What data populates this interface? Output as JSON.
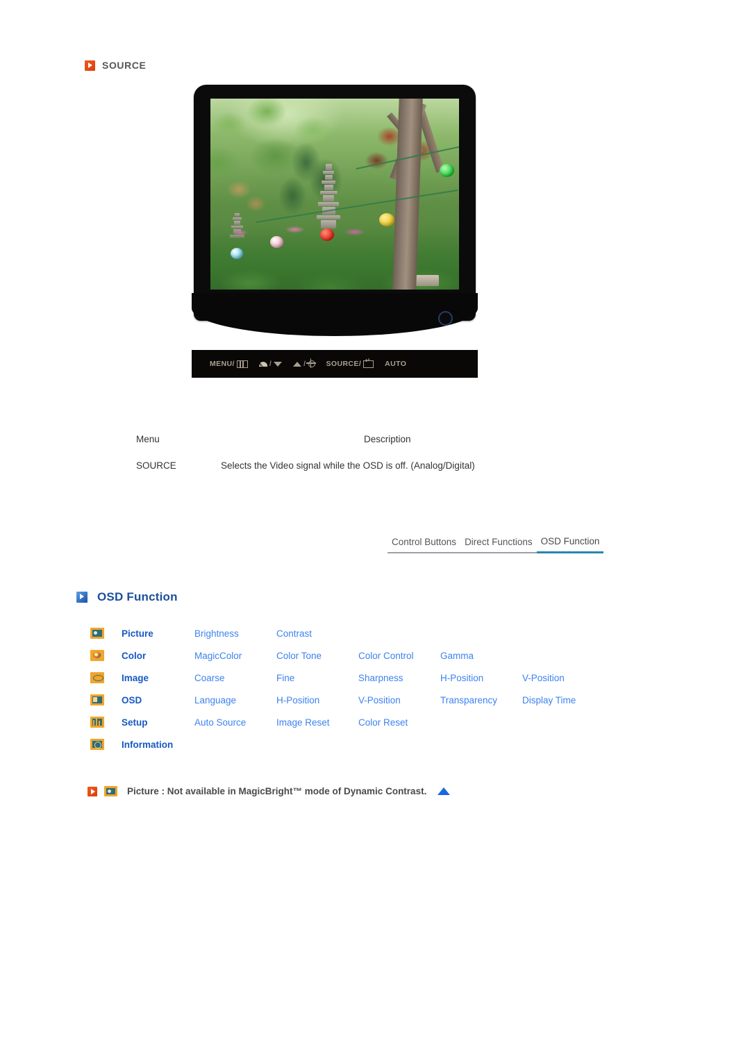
{
  "source_section": {
    "heading": "SOURCE",
    "bullet_icon": "orange-play-bullet-icon"
  },
  "monitor": {
    "screen_image_description": "Garden scene with stone pagoda, trees and colorful paper lanterns",
    "power_indicator": "power-led-ring",
    "buttons": [
      {
        "label": "MENU/",
        "glyph": "menu-icon"
      },
      {
        "label": "",
        "glyph": "magicbright-icon",
        "separator": "/",
        "glyph2": "down-arrow-icon"
      },
      {
        "label": "",
        "glyph": "up-arrow-icon",
        "separator": "/",
        "glyph2": "brightness-sun-icon"
      },
      {
        "label": "SOURCE/",
        "glyph": "enter-icon"
      },
      {
        "label": "AUTO",
        "glyph": ""
      }
    ]
  },
  "description_table": {
    "headers": {
      "menu": "Menu",
      "description": "Description"
    },
    "rows": [
      {
        "menu": "SOURCE",
        "description": "Selects the Video signal while the OSD is off. (Analog/Digital)"
      }
    ]
  },
  "tabs": [
    {
      "label": "Control Buttons",
      "active": false
    },
    {
      "label": "Direct Functions",
      "active": false
    },
    {
      "label": "OSD Function",
      "active": true
    }
  ],
  "osd_function": {
    "heading": "OSD Function",
    "bullet_icon": "blue-play-bullet-icon",
    "rows": [
      {
        "icon": "picture-icon",
        "category": "Picture",
        "items": [
          "Brightness",
          "Contrast"
        ]
      },
      {
        "icon": "color-icon",
        "category": "Color",
        "items": [
          "MagicColor",
          "Color Tone",
          "Color Control",
          "Gamma"
        ]
      },
      {
        "icon": "image-icon",
        "category": "Image",
        "items": [
          "Coarse",
          "Fine",
          "Sharpness",
          "H-Position",
          "V-Position"
        ]
      },
      {
        "icon": "osd-icon",
        "category": "OSD",
        "items": [
          "Language",
          "H-Position",
          "V-Position",
          "Transparency",
          "Display Time"
        ]
      },
      {
        "icon": "setup-icon",
        "category": "Setup",
        "items": [
          "Auto Source",
          "Image Reset",
          "Color Reset"
        ]
      },
      {
        "icon": "information-icon",
        "category": "Information",
        "items": []
      }
    ]
  },
  "footnote": {
    "bullet_icon": "orange-play-bullet-icon",
    "menu_icon": "picture-icon",
    "text": "Picture : Not available in MagicBright™ mode of Dynamic Contrast.",
    "arrow_icon": "blue-up-triangle-icon"
  },
  "colors": {
    "orange_bullet": "#dd3d09",
    "blue_bullet": "#1750a8",
    "heading_blue": "#1b4f9c",
    "category_blue": "#1659c4",
    "item_blue": "#3c82f0",
    "icon_orange": "#f0a52b",
    "icon_teal": "#2c6d78",
    "tab_underline_active": "#2a85b0",
    "tab_underline_inactive": "#9aa0a6",
    "body_text": "#333333"
  }
}
